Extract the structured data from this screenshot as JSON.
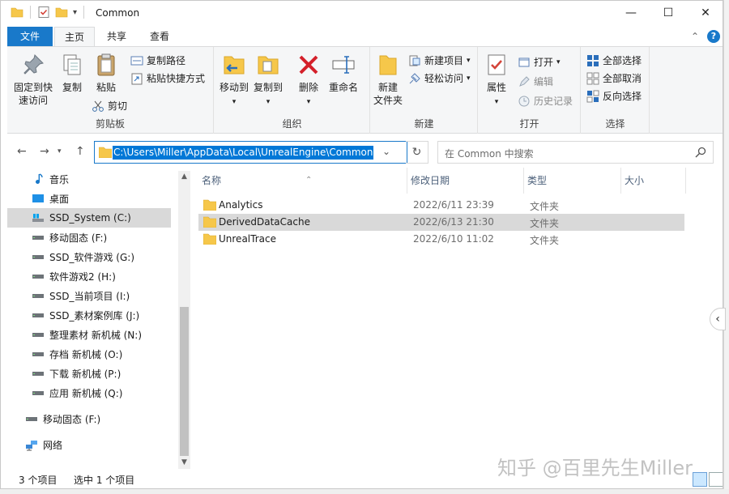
{
  "window": {
    "title": "Common",
    "controls": {
      "minimize": "—",
      "maximize": "☐",
      "close": "✕"
    }
  },
  "tabs": {
    "file": "文件",
    "home": "主页",
    "share": "共享",
    "view": "查看",
    "collapse": "⌃",
    "help": "?"
  },
  "ribbon": {
    "clipboard": {
      "label": "剪贴板",
      "pin": "固定到快速访问",
      "pin_line1": "固定到快",
      "pin_line2": "速访问",
      "copy": "复制",
      "paste": "粘贴",
      "copy_path": "复制路径",
      "paste_shortcut": "粘贴快捷方式",
      "cut": "剪切"
    },
    "organize": {
      "label": "组织",
      "move_to": "移动到",
      "copy_to": "复制到",
      "delete": "删除",
      "rename": "重命名"
    },
    "new": {
      "label": "新建",
      "new_folder_line1": "新建",
      "new_folder_line2": "文件夹",
      "new_item": "新建项目",
      "easy_access": "轻松访问"
    },
    "open": {
      "label": "打开",
      "properties": "属性",
      "open": "打开",
      "edit": "编辑",
      "history": "历史记录"
    },
    "select": {
      "label": "选择",
      "select_all": "全部选择",
      "select_none": "全部取消",
      "invert": "反向选择"
    }
  },
  "address": {
    "path": "C:\\Users\\Miller\\AppData\\Local\\UnrealEngine\\Common",
    "search_placeholder": "在 Common 中搜索"
  },
  "nav": {
    "items": [
      {
        "label": "音乐",
        "icon": "music-icon"
      },
      {
        "label": "桌面",
        "icon": "desktop-icon"
      },
      {
        "label": "SSD_System (C:)",
        "icon": "system-drive-icon",
        "selected": true
      },
      {
        "label": "移动固态 (F:)",
        "icon": "drive-icon"
      },
      {
        "label": "SSD_软件游戏 (G:)",
        "icon": "drive-icon"
      },
      {
        "label": "软件游戏2 (H:)",
        "icon": "drive-icon"
      },
      {
        "label": "SSD_当前项目 (I:)",
        "icon": "drive-icon"
      },
      {
        "label": "SSD_素材案例库 (J:)",
        "icon": "drive-icon"
      },
      {
        "label": "整理素材 新机械 (N:)",
        "icon": "drive-icon"
      },
      {
        "label": "存档 新机械 (O:)",
        "icon": "drive-icon"
      },
      {
        "label": "下载 新机械 (P:)",
        "icon": "drive-icon"
      },
      {
        "label": "应用 新机械 (Q:)",
        "icon": "drive-icon"
      },
      {
        "label": "移动固态 (F:)",
        "icon": "drive-icon"
      },
      {
        "label": "网络",
        "icon": "network-icon"
      }
    ]
  },
  "columns": {
    "name": "名称",
    "date": "修改日期",
    "type": "类型",
    "size": "大小"
  },
  "files": [
    {
      "name": "Analytics",
      "date": "2022/6/11 23:39",
      "type": "文件夹"
    },
    {
      "name": "DerivedDataCache",
      "date": "2022/6/13 21:30",
      "type": "文件夹",
      "selected": true
    },
    {
      "name": "UnrealTrace",
      "date": "2022/6/10 11:02",
      "type": "文件夹"
    }
  ],
  "status": {
    "count": "3 个项目",
    "selected": "选中 1 个项目"
  },
  "watermark": "知乎 @百里先生Miller",
  "colors": {
    "accent": "#1979ca",
    "selection": "#d9d9d9",
    "folder": "#f6c74a"
  }
}
